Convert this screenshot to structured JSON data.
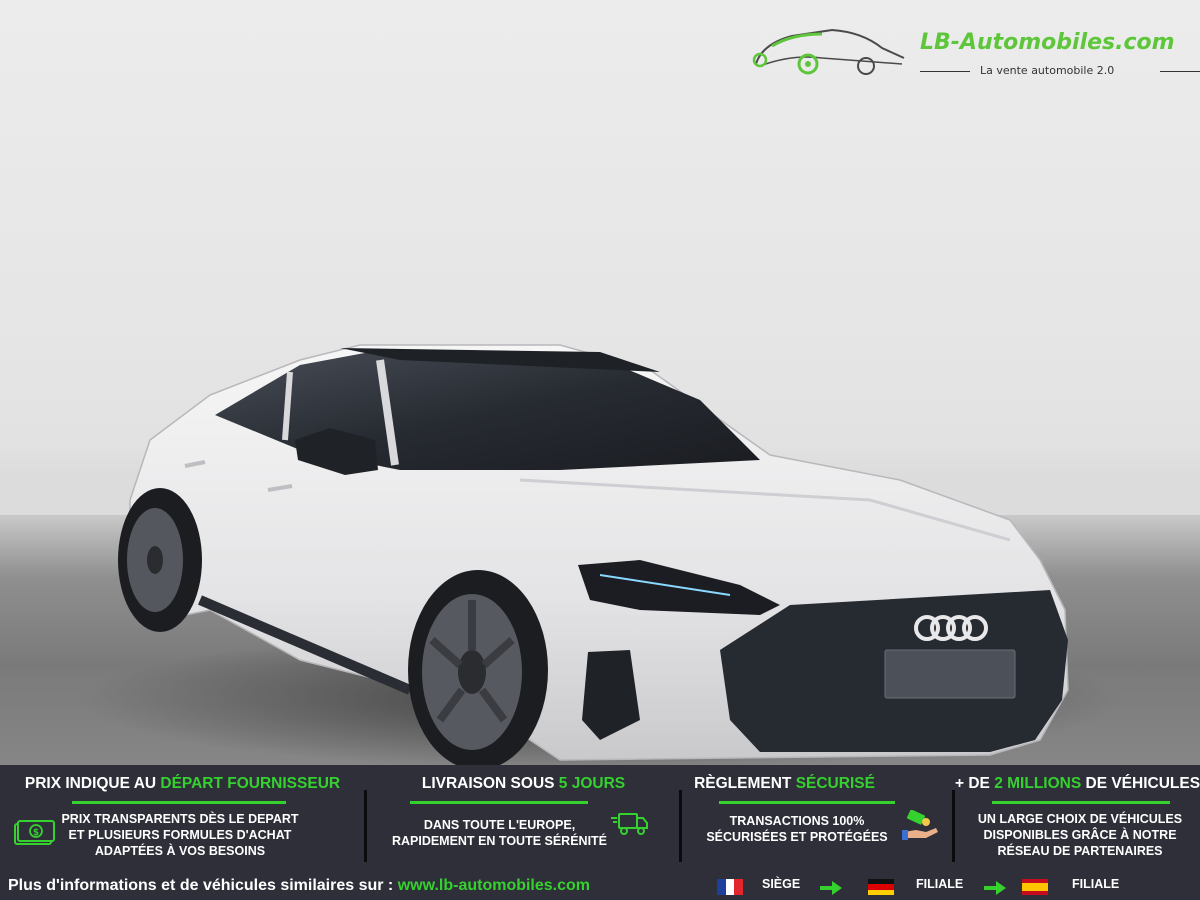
{
  "logo": {
    "name": "LB-Automobiles.com",
    "tagline": "La vente automobile 2.0",
    "icon": "sports-car-logo-icon"
  },
  "photo": {
    "subject": "car-photo",
    "brand_badge": "four-rings-badge"
  },
  "colors": {
    "accent": "#35d12e",
    "banner_bg": "#2e2f39",
    "logo_green": "#5ec63a"
  },
  "features": [
    {
      "title_pre": "PRIX INDIQUE AU ",
      "title_hl": "DÉPART FOURNISSEUR",
      "title_post": "",
      "lines": [
        "PRIX TRANSPARENTS DÈS LE DEPART",
        "ET PLUSIEURS FORMULES D'ACHAT",
        "ADAPTÉES À VOS BESOINS"
      ],
      "icon": "banknote-icon"
    },
    {
      "title_pre": "LIVRAISON SOUS ",
      "title_hl": "5 JOURS",
      "title_post": "",
      "lines": [
        "DANS TOUTE L'EUROPE,",
        "RAPIDEMENT EN TOUTE SÉRÉNITÉ"
      ],
      "icon": "delivery-truck-icon"
    },
    {
      "title_pre": "RÈGLEMENT ",
      "title_hl": "SÉCURISÉ",
      "title_post": "",
      "lines": [
        "TRANSACTIONS 100%",
        "SÉCURISÉES ET PROTÉGÉES"
      ],
      "icon": "payment-hand-icon"
    },
    {
      "title_pre": "+ DE ",
      "title_hl": "2 MILLIONS",
      "title_post": " DE VÉHICULES",
      "lines": [
        "UN LARGE CHOIX DE VÉHICULES",
        "DISPONIBLES GRÂCE À NOTRE",
        "RÉSEAU DE PARTENAIRES"
      ],
      "icon": ""
    }
  ],
  "footer": {
    "text": "Plus d'informations et de véhicules similaires sur : ",
    "url": "www.lb-automobiles.com"
  },
  "locations": [
    {
      "flag": "france-flag-icon",
      "label": "SIÈGE"
    },
    {
      "flag": "germany-flag-icon",
      "label": "FILIALE"
    },
    {
      "flag": "spain-flag-icon",
      "label": "FILIALE"
    }
  ]
}
